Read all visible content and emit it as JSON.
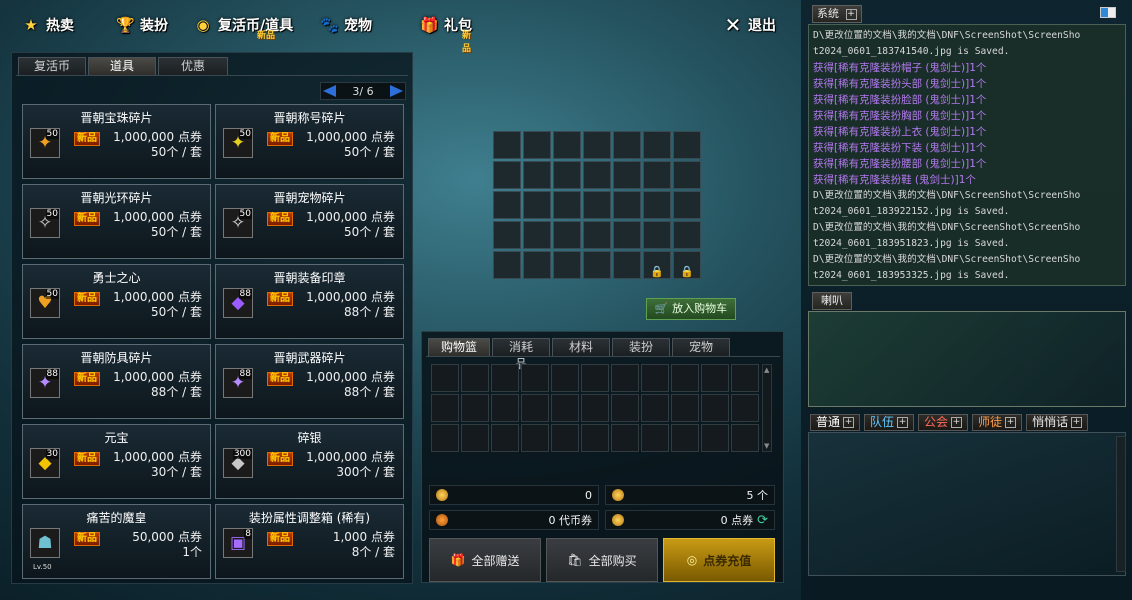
{
  "nav": [
    {
      "label": "热卖",
      "icon": "★",
      "new": ""
    },
    {
      "label": "装扮",
      "icon": "🏆",
      "new": ""
    },
    {
      "label": "复活币/道具",
      "icon": "◉",
      "new": "新品"
    },
    {
      "label": "宠物",
      "icon": "🐾",
      "new": ""
    },
    {
      "label": "礼包",
      "icon": "🎁",
      "new": "新品"
    }
  ],
  "exit_label": "退出",
  "left_tabs": [
    "复活币",
    "道具",
    "优惠"
  ],
  "active_left_tab": "道具",
  "pager": "3/ 6",
  "items": [
    {
      "name": "晋朝宝珠碎片",
      "stack": "50",
      "icon": "✦",
      "icon_color": "#f0a020",
      "price": "1,000,000 点券",
      "qty": "50个 / 套"
    },
    {
      "name": "晋朝称号碎片",
      "stack": "50",
      "icon": "✦",
      "icon_color": "#e6d020",
      "price": "1,000,000 点券",
      "qty": "50个 / 套"
    },
    {
      "name": "晋朝光环碎片",
      "stack": "50",
      "icon": "✧",
      "icon_color": "#d0d0d0",
      "price": "1,000,000 点券",
      "qty": "50个 / 套"
    },
    {
      "name": "晋朝宠物碎片",
      "stack": "50",
      "icon": "✧",
      "icon_color": "#e0e0e0",
      "price": "1,000,000 点券",
      "qty": "50个 / 套"
    },
    {
      "name": "勇士之心",
      "stack": "50",
      "icon": "♥",
      "icon_color": "#f0a020",
      "price": "1,000,000 点券",
      "qty": "50个 / 套"
    },
    {
      "name": "晋朝装备印章",
      "stack": "88",
      "icon": "◆",
      "icon_color": "#9c5cff",
      "price": "1,000,000 点券",
      "qty": "88个 / 套"
    },
    {
      "name": "晋朝防具碎片",
      "stack": "88",
      "icon": "✦",
      "icon_color": "#b58cff",
      "price": "1,000,000 点券",
      "qty": "88个 / 套"
    },
    {
      "name": "晋朝武器碎片",
      "stack": "88",
      "icon": "✦",
      "icon_color": "#b58cff",
      "price": "1,000,000 点券",
      "qty": "88个 / 套"
    },
    {
      "name": "元宝",
      "stack": "30",
      "icon": "◆",
      "icon_color": "#f2c400",
      "price": "1,000,000 点券",
      "qty": "30个 / 套"
    },
    {
      "name": "碎银",
      "stack": "300",
      "icon": "◆",
      "icon_color": "#c8c8c8",
      "price": "1,000,000 点券",
      "qty": "300个 / 套"
    },
    {
      "name": "痛苦的魔皇",
      "stack": "",
      "icon": "☗",
      "icon_color": "#6fc0d0",
      "price": "50,000 点券",
      "qty": "1个",
      "lv": "Lv.50"
    },
    {
      "name": "装扮属性调整箱 (稀有)",
      "stack": "8",
      "icon": "▣",
      "icon_color": "#a46cff",
      "price": "1,000 点券",
      "qty": "8个 / 套"
    }
  ],
  "new_tag": "新品",
  "add_cart_label": "放入购物车",
  "cart_tabs": [
    "购物篮",
    "消耗品",
    "材料",
    "装扮",
    "宠物"
  ],
  "active_cart_tab": "购物篮",
  "stats": {
    "cash_value": "0",
    "coin_count": "5 个",
    "token_value": "0 代币券",
    "points_value": "0 点券"
  },
  "buttons": {
    "gift_all": "全部赠送",
    "buy_all": "全部购买",
    "recharge": "点券充值"
  },
  "system_tab": "系统",
  "log": [
    {
      "t": "D\\更改位置的文档\\我的文档\\DNF\\ScreenShot\\ScreenSho",
      "k": "sys"
    },
    {
      "t": "t2024_0601_183741540.jpg is Saved.",
      "k": "sys"
    },
    {
      "t": "获得[稀有克隆装扮帽子 (鬼剑士)]1个",
      "k": "get"
    },
    {
      "t": "获得[稀有克隆装扮头部 (鬼剑士)]1个",
      "k": "get"
    },
    {
      "t": "获得[稀有克隆装扮脸部 (鬼剑士)]1个",
      "k": "get"
    },
    {
      "t": "获得[稀有克隆装扮胸部 (鬼剑士)]1个",
      "k": "get"
    },
    {
      "t": "获得[稀有克隆装扮上衣 (鬼剑士)]1个",
      "k": "get"
    },
    {
      "t": "获得[稀有克隆装扮下装 (鬼剑士)]1个",
      "k": "get"
    },
    {
      "t": "获得[稀有克隆装扮腰部 (鬼剑士)]1个",
      "k": "get"
    },
    {
      "t": "获得[稀有克隆装扮鞋 (鬼剑士)]1个",
      "k": "get"
    },
    {
      "t": "D\\更改位置的文档\\我的文档\\DNF\\ScreenShot\\ScreenSho",
      "k": "sys"
    },
    {
      "t": "t2024_0601_183922152.jpg is Saved.",
      "k": "sys"
    },
    {
      "t": "D\\更改位置的文档\\我的文档\\DNF\\ScreenShot\\ScreenSho",
      "k": "sys"
    },
    {
      "t": "t2024_0601_183951823.jpg is Saved.",
      "k": "sys"
    },
    {
      "t": "D\\更改位置的文档\\我的文档\\DNF\\ScreenShot\\ScreenSho",
      "k": "sys"
    },
    {
      "t": "t2024_0601_183953325.jpg is Saved.",
      "k": "sys"
    }
  ],
  "horn_tab": "喇叭",
  "chat_tabs": [
    {
      "label": "普通",
      "color": "#ffffff"
    },
    {
      "label": "队伍",
      "color": "#5ec8ff"
    },
    {
      "label": "公会",
      "color": "#ff6a5a"
    },
    {
      "label": "师徒",
      "color": "#ff9c4a"
    },
    {
      "label": "悄悄话",
      "color": "#e8e8e8"
    }
  ]
}
